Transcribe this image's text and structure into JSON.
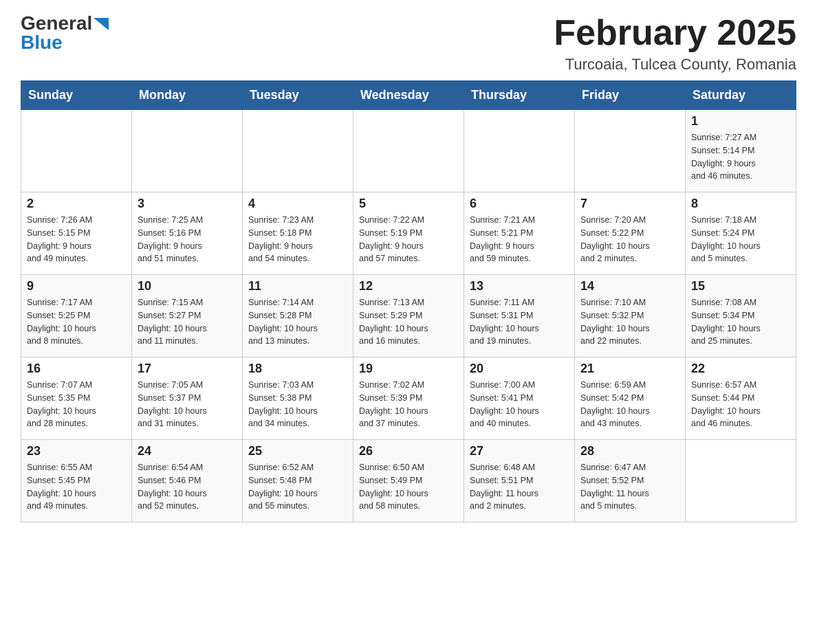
{
  "header": {
    "logo": {
      "general": "General",
      "blue": "Blue",
      "arrow": "▶"
    },
    "title": "February 2025",
    "location": "Turcoaia, Tulcea County, Romania"
  },
  "weekdays": [
    "Sunday",
    "Monday",
    "Tuesday",
    "Wednesday",
    "Thursday",
    "Friday",
    "Saturday"
  ],
  "weeks": [
    [
      {
        "day": "",
        "info": ""
      },
      {
        "day": "",
        "info": ""
      },
      {
        "day": "",
        "info": ""
      },
      {
        "day": "",
        "info": ""
      },
      {
        "day": "",
        "info": ""
      },
      {
        "day": "",
        "info": ""
      },
      {
        "day": "1",
        "info": "Sunrise: 7:27 AM\nSunset: 5:14 PM\nDaylight: 9 hours\nand 46 minutes."
      }
    ],
    [
      {
        "day": "2",
        "info": "Sunrise: 7:26 AM\nSunset: 5:15 PM\nDaylight: 9 hours\nand 49 minutes."
      },
      {
        "day": "3",
        "info": "Sunrise: 7:25 AM\nSunset: 5:16 PM\nDaylight: 9 hours\nand 51 minutes."
      },
      {
        "day": "4",
        "info": "Sunrise: 7:23 AM\nSunset: 5:18 PM\nDaylight: 9 hours\nand 54 minutes."
      },
      {
        "day": "5",
        "info": "Sunrise: 7:22 AM\nSunset: 5:19 PM\nDaylight: 9 hours\nand 57 minutes."
      },
      {
        "day": "6",
        "info": "Sunrise: 7:21 AM\nSunset: 5:21 PM\nDaylight: 9 hours\nand 59 minutes."
      },
      {
        "day": "7",
        "info": "Sunrise: 7:20 AM\nSunset: 5:22 PM\nDaylight: 10 hours\nand 2 minutes."
      },
      {
        "day": "8",
        "info": "Sunrise: 7:18 AM\nSunset: 5:24 PM\nDaylight: 10 hours\nand 5 minutes."
      }
    ],
    [
      {
        "day": "9",
        "info": "Sunrise: 7:17 AM\nSunset: 5:25 PM\nDaylight: 10 hours\nand 8 minutes."
      },
      {
        "day": "10",
        "info": "Sunrise: 7:15 AM\nSunset: 5:27 PM\nDaylight: 10 hours\nand 11 minutes."
      },
      {
        "day": "11",
        "info": "Sunrise: 7:14 AM\nSunset: 5:28 PM\nDaylight: 10 hours\nand 13 minutes."
      },
      {
        "day": "12",
        "info": "Sunrise: 7:13 AM\nSunset: 5:29 PM\nDaylight: 10 hours\nand 16 minutes."
      },
      {
        "day": "13",
        "info": "Sunrise: 7:11 AM\nSunset: 5:31 PM\nDaylight: 10 hours\nand 19 minutes."
      },
      {
        "day": "14",
        "info": "Sunrise: 7:10 AM\nSunset: 5:32 PM\nDaylight: 10 hours\nand 22 minutes."
      },
      {
        "day": "15",
        "info": "Sunrise: 7:08 AM\nSunset: 5:34 PM\nDaylight: 10 hours\nand 25 minutes."
      }
    ],
    [
      {
        "day": "16",
        "info": "Sunrise: 7:07 AM\nSunset: 5:35 PM\nDaylight: 10 hours\nand 28 minutes."
      },
      {
        "day": "17",
        "info": "Sunrise: 7:05 AM\nSunset: 5:37 PM\nDaylight: 10 hours\nand 31 minutes."
      },
      {
        "day": "18",
        "info": "Sunrise: 7:03 AM\nSunset: 5:38 PM\nDaylight: 10 hours\nand 34 minutes."
      },
      {
        "day": "19",
        "info": "Sunrise: 7:02 AM\nSunset: 5:39 PM\nDaylight: 10 hours\nand 37 minutes."
      },
      {
        "day": "20",
        "info": "Sunrise: 7:00 AM\nSunset: 5:41 PM\nDaylight: 10 hours\nand 40 minutes."
      },
      {
        "day": "21",
        "info": "Sunrise: 6:59 AM\nSunset: 5:42 PM\nDaylight: 10 hours\nand 43 minutes."
      },
      {
        "day": "22",
        "info": "Sunrise: 6:57 AM\nSunset: 5:44 PM\nDaylight: 10 hours\nand 46 minutes."
      }
    ],
    [
      {
        "day": "23",
        "info": "Sunrise: 6:55 AM\nSunset: 5:45 PM\nDaylight: 10 hours\nand 49 minutes."
      },
      {
        "day": "24",
        "info": "Sunrise: 6:54 AM\nSunset: 5:46 PM\nDaylight: 10 hours\nand 52 minutes."
      },
      {
        "day": "25",
        "info": "Sunrise: 6:52 AM\nSunset: 5:48 PM\nDaylight: 10 hours\nand 55 minutes."
      },
      {
        "day": "26",
        "info": "Sunrise: 6:50 AM\nSunset: 5:49 PM\nDaylight: 10 hours\nand 58 minutes."
      },
      {
        "day": "27",
        "info": "Sunrise: 6:48 AM\nSunset: 5:51 PM\nDaylight: 11 hours\nand 2 minutes."
      },
      {
        "day": "28",
        "info": "Sunrise: 6:47 AM\nSunset: 5:52 PM\nDaylight: 11 hours\nand 5 minutes."
      },
      {
        "day": "",
        "info": ""
      }
    ]
  ]
}
